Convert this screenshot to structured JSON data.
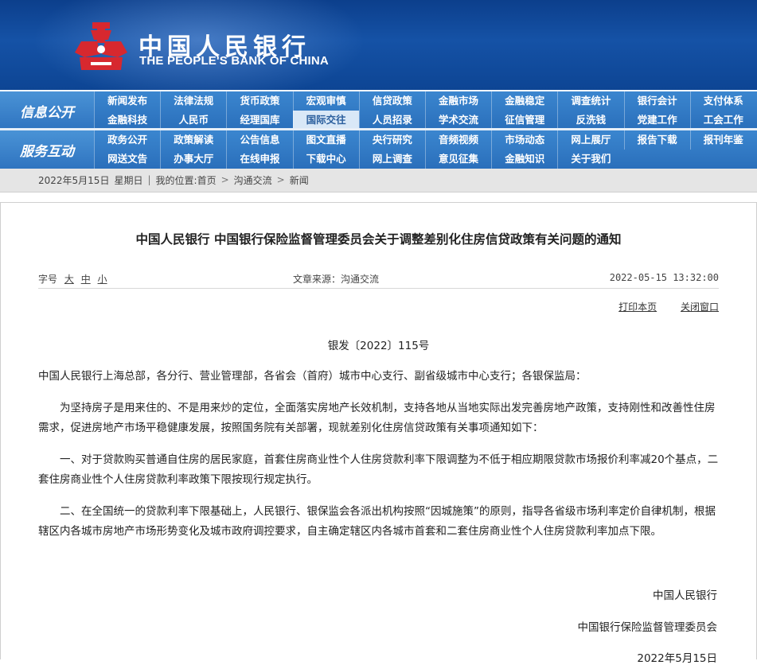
{
  "header": {
    "brand_cn": "中国人民银行",
    "brand_en": "THE PEOPLE'S BANK OF CHINA",
    "logo_icon": "pboc-emblem-icon",
    "colors": {
      "banner": "#1552a6",
      "logo": "#d7282f"
    }
  },
  "nav": {
    "section1": {
      "label": "信息公开",
      "row1": [
        "新闻发布",
        "法律法规",
        "货币政策",
        "宏观审慎",
        "信贷政策",
        "金融市场",
        "金融稳定",
        "调查统计",
        "银行会计",
        "支付体系"
      ],
      "row2": [
        "金融科技",
        "人民币",
        "经理国库",
        "国际交往",
        "人员招录",
        "学术交流",
        "征信管理",
        "反洗钱",
        "党建工作",
        "工会工作"
      ]
    },
    "section2": {
      "label": "服务互动",
      "row1": [
        "政务公开",
        "政策解读",
        "公告信息",
        "图文直播",
        "央行研究",
        "音频视频",
        "市场动态",
        "网上展厅",
        "报告下载",
        "报刊年鉴"
      ],
      "row2": [
        "网送文告",
        "办事大厅",
        "在线申报",
        "下载中心",
        "网上调查",
        "意见征集",
        "金融知识",
        "关于我们",
        "",
        ""
      ]
    }
  },
  "breadcrumb": {
    "date": "2022年5月15日",
    "weekday": "星期日",
    "location_label": "我的位置:",
    "items": [
      "首页",
      "沟通交流",
      "新闻"
    ]
  },
  "article": {
    "title": "中国人民银行 中国银行保险监督管理委员会关于调整差别化住房信贷政策有关问题的通知",
    "font_size": {
      "label": "字号",
      "large": "大",
      "medium": "中",
      "small": "小"
    },
    "source": "文章来源：沟通交流",
    "datetime": "2022-05-15 13:32:00",
    "print": "打印本页",
    "close": "关闭窗口",
    "doc_no": "银发〔2022〕115号",
    "addressee": "中国人民银行上海总部，各分行、营业管理部，各省会（首府）城市中心支行、副省级城市中心支行；各银保监局：",
    "paragraphs": [
      "为坚持房子是用来住的、不是用来炒的定位，全面落实房地产长效机制，支持各地从当地实际出发完善房地产政策，支持刚性和改善性住房需求，促进房地产市场平稳健康发展，按照国务院有关部署，现就差别化住房信贷政策有关事项通知如下：",
      "一、对于贷款购买普通自住房的居民家庭，首套住房商业性个人住房贷款利率下限调整为不低于相应期限贷款市场报价利率减20个基点，二套住房商业性个人住房贷款利率政策下限按现行规定执行。",
      "二、在全国统一的贷款利率下限基础上，人民银行、银保监会各派出机构按照“因城施策”的原则，指导各省级市场利率定价自律机制，根据辖区内各城市房地产市场形势变化及城市政府调控要求，自主确定辖区内各城市首套和二套住房商业性个人住房贷款利率加点下限。"
    ],
    "signatures": [
      "中国人民银行",
      "中国银行保险监督管理委员会",
      "2022年5月15日"
    ]
  }
}
